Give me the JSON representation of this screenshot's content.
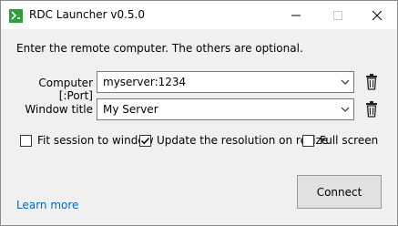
{
  "window": {
    "title": "RDC Launcher v0.5.0",
    "icon": "rdc-launcher-app-icon",
    "controls": [
      "minimize",
      "maximize",
      "close"
    ]
  },
  "instruction": "Enter the remote computer. The others are optional.",
  "computer": {
    "label": "Computer [:Port]",
    "value": "myserver:1234"
  },
  "window_title": {
    "label": "Window title",
    "value": "My Server"
  },
  "options": {
    "fit_session": {
      "label": "Fit session to window",
      "checked": false
    },
    "update_resolution": {
      "label": "Update the resolution on resize",
      "checked": true
    },
    "full_screen": {
      "label": "Full screen",
      "checked": false
    }
  },
  "learn_more": "Learn more",
  "connect_label": "Connect",
  "colors": {
    "accent_green": "#2e9e3e",
    "link": "#0066cc",
    "content_bg": "#f0f0f0"
  }
}
